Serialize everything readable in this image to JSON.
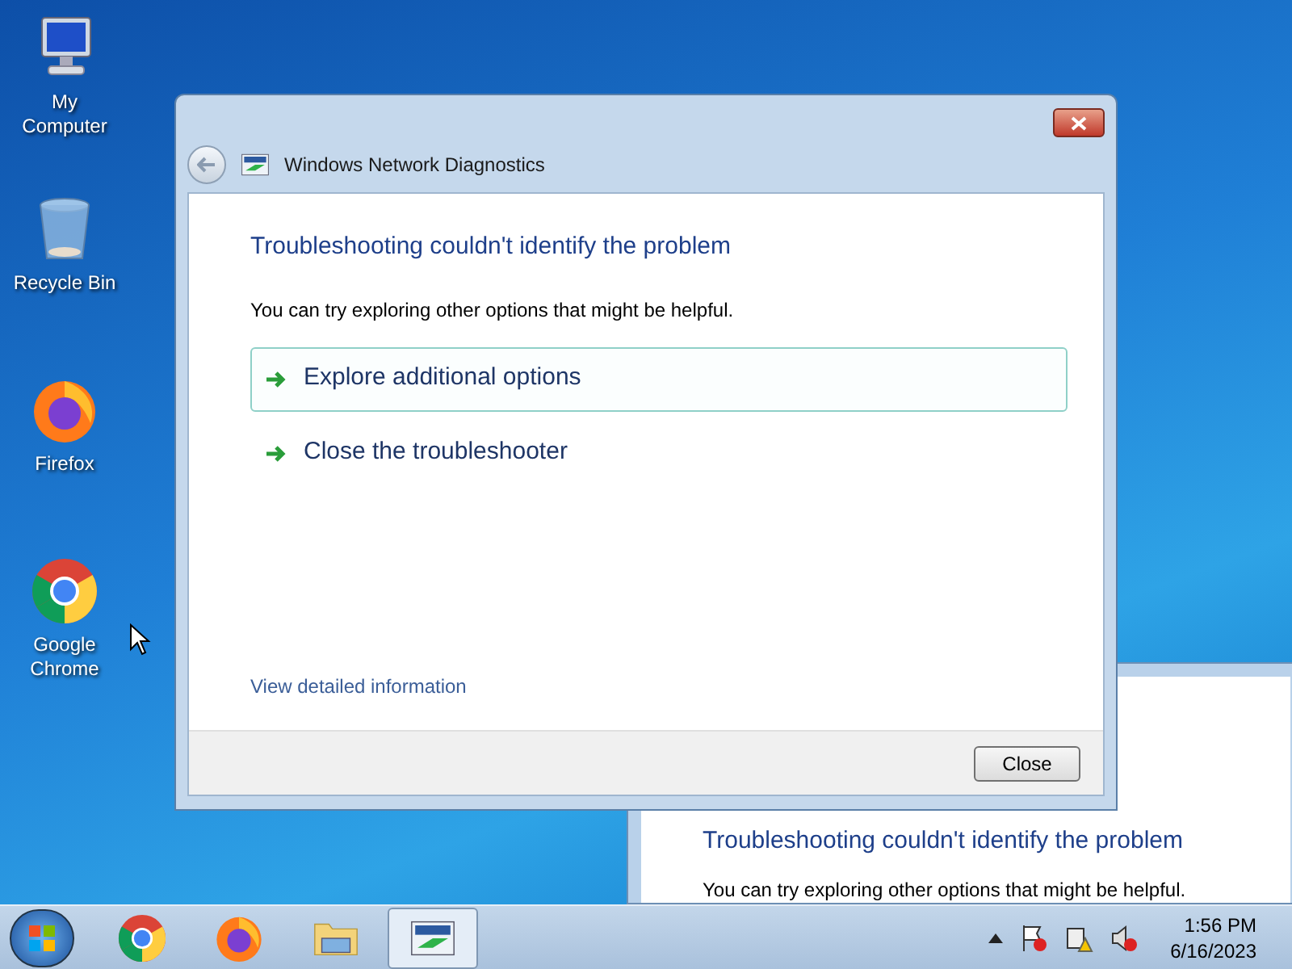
{
  "desktop_icons": [
    {
      "label": "My Computer",
      "kind": "computer"
    },
    {
      "label": "Recycle Bin",
      "kind": "bin"
    },
    {
      "label": "Firefox",
      "kind": "firefox"
    },
    {
      "label": "Google Chrome",
      "kind": "chrome"
    }
  ],
  "background_window": {
    "heading": "Troubleshooting couldn't identify the problem",
    "text": "You can try exploring other options that might be helpful."
  },
  "dialog": {
    "title": "Windows Network Diagnostics",
    "heading": "Troubleshooting couldn't identify the problem",
    "text": "You can try exploring other options that might be helpful.",
    "options": [
      {
        "label": "Explore additional options",
        "selected": true
      },
      {
        "label": "Close the troubleshooter",
        "selected": false
      }
    ],
    "link": "View detailed information",
    "button": "Close"
  },
  "taskbar": {
    "items": [
      {
        "kind": "chrome",
        "selected": false
      },
      {
        "kind": "firefox",
        "selected": false
      },
      {
        "kind": "folder",
        "selected": false
      },
      {
        "kind": "network",
        "selected": true
      }
    ],
    "time": "1:56 PM",
    "date": "6/16/2023"
  }
}
